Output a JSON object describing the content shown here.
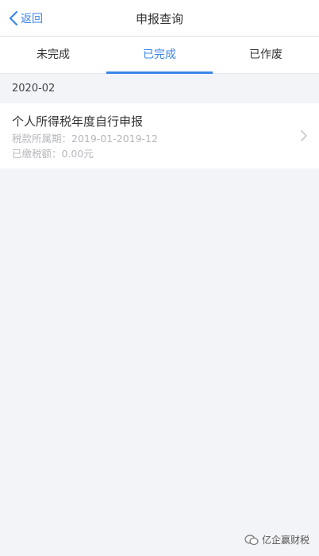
{
  "nav": {
    "back_label": "返回",
    "title": "申报查询"
  },
  "tabs": [
    {
      "label": "未完成",
      "active": false
    },
    {
      "label": "已完成",
      "active": true
    },
    {
      "label": "已作废",
      "active": false
    }
  ],
  "group": {
    "header": "2020-02",
    "items": [
      {
        "title": "个人所得税年度自行申报",
        "period": "税款所属期：2019-01-2019-12",
        "paid": "已缴税额：0.00元"
      }
    ]
  },
  "watermark": {
    "text": "亿企赢财税"
  },
  "colors": {
    "accent": "#3a86e8",
    "background": "#f3f4f8",
    "muted_text": "#b5b7bd"
  }
}
